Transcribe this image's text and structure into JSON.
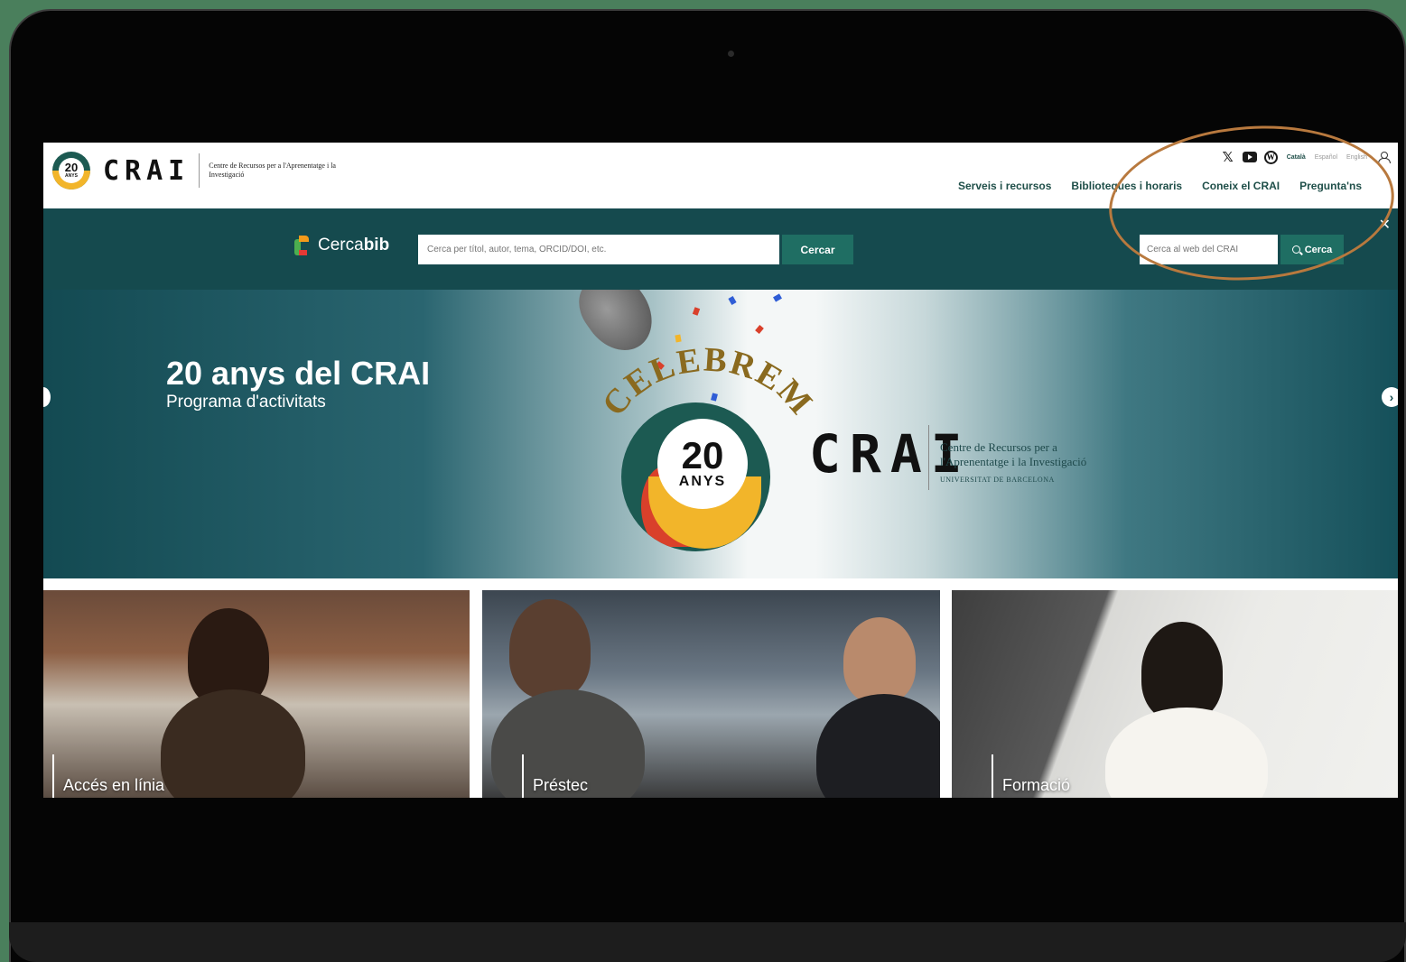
{
  "header": {
    "logo": {
      "badge_number": "20",
      "badge_text": "ANYS",
      "wordmark": "CRAI",
      "subtitle": "Centre de Recursos per a l'Aprenentatge i la Investigació"
    },
    "social": [
      "x-icon",
      "youtube-icon",
      "wordpress-icon"
    ],
    "languages": [
      {
        "label": "Català",
        "active": true
      },
      {
        "label": "Español",
        "active": false
      },
      {
        "label": "English",
        "active": false
      }
    ],
    "nav": [
      "Serveis i recursos",
      "Biblioteques i horaris",
      "Coneix el CRAI",
      "Pregunta'ns"
    ]
  },
  "search": {
    "cercabib_brand_a": "Cerca",
    "cercabib_brand_b": "bib",
    "cercabib_placeholder": "Cerca per títol, autor, tema, ORCID/DOI, etc.",
    "cercabib_button": "Cercar",
    "site_placeholder": "Cerca al web del CRAI",
    "site_button": "Cerca",
    "close": "✕"
  },
  "hero": {
    "title": "20 anys del CRAI",
    "subtitle": "Programa d'activitats",
    "celebrem": "CELEBREM",
    "badge_number": "20",
    "badge_text": "ANYS",
    "wordmark": "CRAI",
    "org_line1": "Centre de Recursos per a",
    "org_line2": "l'Aprenentatge i la Investigació",
    "university": "UNIVERSITAT DE BARCELONA",
    "next_arrow": "›"
  },
  "cards": [
    "Accés en línia",
    "Préstec",
    "Formació"
  ],
  "colors": {
    "brand_dark": "#154a4e",
    "brand_button": "#1f6e63",
    "accent_yellow": "#f2b52a",
    "accent_red": "#d9402b",
    "highlight": "#b8793e",
    "background": "#4a7f5c"
  }
}
